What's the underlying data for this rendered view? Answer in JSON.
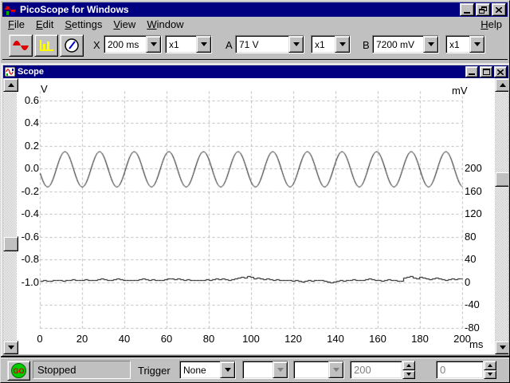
{
  "window": {
    "title": "PicoScope for Windows"
  },
  "menu": {
    "items": [
      {
        "label": "File"
      },
      {
        "label": "Edit"
      },
      {
        "label": "Settings"
      },
      {
        "label": "View"
      },
      {
        "label": "Window"
      }
    ],
    "help_label": "Help"
  },
  "toolbar": {
    "buttons": [
      {
        "name": "scope-view"
      },
      {
        "name": "spectrum-view"
      },
      {
        "name": "meter-view"
      }
    ],
    "x_label": "X",
    "timebase_value": "200 ms",
    "x_mult_value": "x1",
    "a_label": "A",
    "a_range_value": "71 V",
    "a_mult_value": "x1",
    "b_label": "B",
    "b_range_value": "7200 mV",
    "b_mult_value": "x1"
  },
  "scope_window": {
    "title": "Scope"
  },
  "chart_data": {
    "type": "line",
    "title": "Scope",
    "grid": "dashed",
    "legend": "none",
    "x_axis": {
      "label": "ms",
      "min": 0,
      "max": 200,
      "ticks": [
        0,
        20,
        40,
        60,
        80,
        100,
        120,
        140,
        160,
        180,
        200
      ]
    },
    "y_axis_left": {
      "label": "V",
      "min": -1.4,
      "max": 0.7,
      "ticks": [
        0.6,
        0.4,
        0.2,
        0.0,
        -0.2,
        -0.4,
        -0.6,
        -0.8,
        -1.0
      ],
      "tick_labels": [
        "0.6",
        "0.4",
        "0.2",
        "0.0",
        "-0.2",
        "-0.4",
        "-0.6",
        "-0.8",
        "-1.0"
      ]
    },
    "y_axis_right": {
      "label": "mV",
      "min": -80,
      "max": 520,
      "ticks": [
        200,
        160,
        120,
        80,
        40,
        0,
        -40,
        -80
      ]
    },
    "series": [
      {
        "name": "channel-a",
        "unit": "V",
        "waveform": "sine",
        "amplitude_v": 0.155,
        "offset_v": -0.005,
        "frequency_hz": 61,
        "period_ms": 16.4,
        "zero_crossing_ms": 7.6,
        "description": "~61 Hz sine, about 0.16 V amplitude centred on 0 V, ~12.3 cycles over 200 ms"
      },
      {
        "name": "channel-b",
        "unit": "mV",
        "waveform": "noise-steps",
        "step_ms": 1.51,
        "description": "noisy stepped trace hovering 0-10 mV around the 0 mV line",
        "values_mv": [
          2,
          3,
          2,
          2,
          3,
          4,
          3,
          2,
          3,
          4,
          5,
          4,
          3,
          4,
          5,
          4,
          3,
          4,
          5,
          6,
          5,
          4,
          4,
          5,
          6,
          5,
          4,
          3,
          4,
          3,
          4,
          5,
          6,
          5,
          4,
          5,
          4,
          3,
          4,
          5,
          7,
          6,
          5,
          6,
          5,
          4,
          5,
          4,
          3,
          4,
          3,
          4,
          5,
          4,
          5,
          6,
          5,
          6,
          5,
          4,
          5,
          6,
          8,
          9,
          8,
          10,
          9,
          7,
          8,
          6,
          5,
          6,
          5,
          4,
          5,
          4,
          3,
          4,
          3,
          2,
          3,
          2,
          1,
          2,
          3,
          2,
          3,
          4,
          3,
          2,
          1,
          0,
          1,
          2,
          3,
          2,
          3,
          4,
          5,
          4,
          3,
          4,
          5,
          6,
          5,
          4,
          3,
          2,
          3,
          5,
          4,
          3,
          2,
          2,
          8,
          9,
          10,
          8,
          7,
          9,
          8,
          6,
          5,
          7,
          8,
          6,
          5,
          4,
          5,
          6,
          5,
          7,
          6
        ]
      }
    ]
  },
  "status_bar": {
    "go_label": "GO",
    "status_text": "Stopped",
    "trigger_label": "Trigger",
    "trigger_mode": "None",
    "threshold_value": "200",
    "delay_value": "0"
  }
}
